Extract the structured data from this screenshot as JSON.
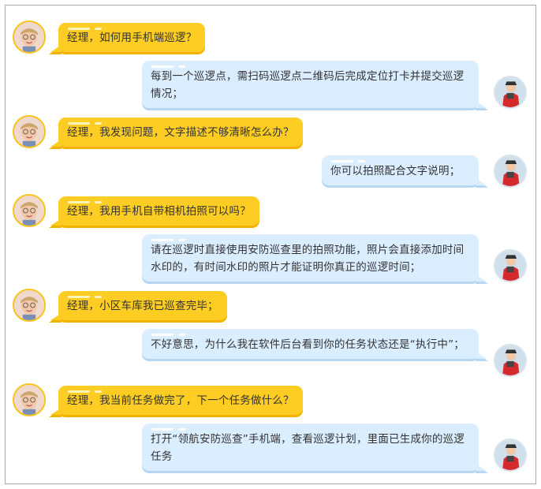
{
  "colors": {
    "manager_bubble": "#fdcd23",
    "guard_bubble": "#dbeeff",
    "text": "#333333",
    "frame_border": "#a9a9a9"
  },
  "icons": {
    "manager_avatar": "child-avatar-icon",
    "guard_avatar": "security-guard-avatar-icon"
  },
  "messages": [
    {
      "from": "manager",
      "text": "经理，如何用手机端巡逻？"
    },
    {
      "from": "guard",
      "text": "每到一个巡逻点，需扫码巡逻点二维码后完成定位打卡并提交巡逻情况；"
    },
    {
      "from": "manager",
      "text": "经理，我发现问题，文字描述不够清晰怎么办？"
    },
    {
      "from": "guard",
      "text": "你可以拍照配合文字说明；"
    },
    {
      "from": "manager",
      "text": "经理，我用手机自带相机拍照可以吗？"
    },
    {
      "from": "guard",
      "text": "请在巡逻时直接使用安防巡查里的拍照功能，照片会直接添加时间水印的，有时间水印的照片才能证明你真正的巡逻时间；"
    },
    {
      "from": "manager",
      "text": "经理，小区车库我已巡查完毕；"
    },
    {
      "from": "guard",
      "text": "不好意思，为什么我在软件后台看到你的任务状态还是“执行中”；"
    },
    {
      "from": "manager",
      "text": "经理，我当前任务做完了，下一个任务做什么？"
    },
    {
      "from": "guard",
      "text": "打开“领航安防巡查”手机端，查看巡逻计划，里面已生成你的巡逻任务"
    }
  ]
}
